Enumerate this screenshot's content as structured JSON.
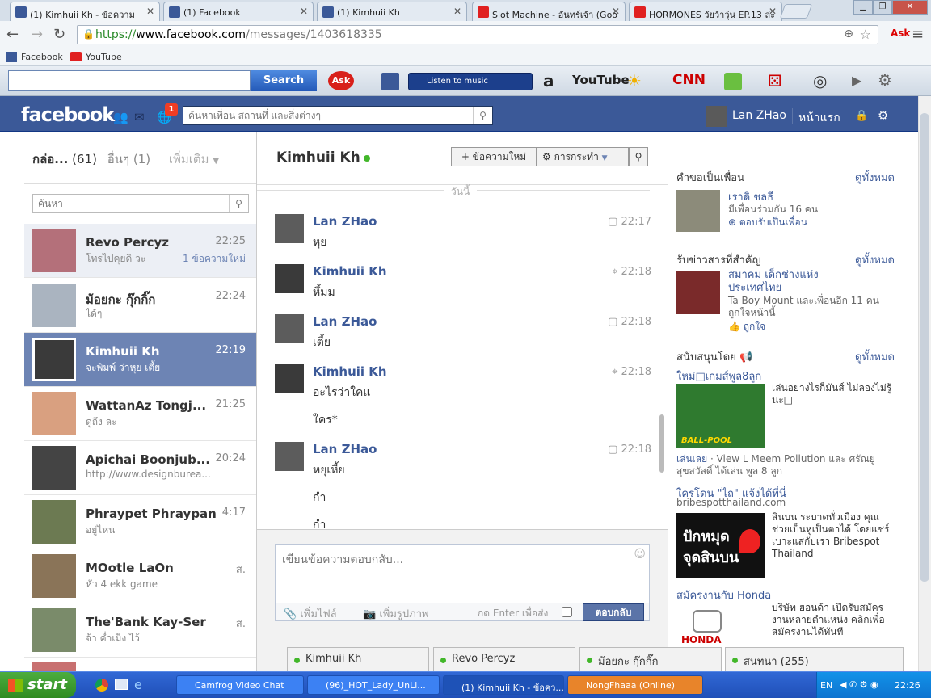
{
  "browser": {
    "tabs": [
      {
        "label": "(1) Kimhuii Kh - ข้อความ",
        "icon": "facebook-icon"
      },
      {
        "label": "(1) Facebook",
        "icon": "facebook-icon"
      },
      {
        "label": "(1) Kimhuii Kh",
        "icon": "facebook-icon"
      },
      {
        "label": "Slot Machine - อันทร์เจ้า (Goo",
        "icon": "youtube-icon"
      },
      {
        "label": "HORMONES วัยว้าวุ่น EP.13 ล่ะ",
        "icon": "youtube-icon"
      }
    ],
    "url_scheme": "https://",
    "url_host": "www.facebook.com",
    "url_path": "/messages/1403618335",
    "bookmarks": [
      "Facebook",
      "YouTube"
    ]
  },
  "asktoolbar": {
    "search_button": "Search",
    "ask_logo": "Ask",
    "music_label": "Listen to music",
    "youtube_label": "YouTube",
    "cnn_label": "CNN"
  },
  "fb": {
    "logo": "facebook",
    "notif_count": "1",
    "search_placeholder": "ค้นหาเพื่อน สถานที่ และสิ่งต่างๆ",
    "user_name": "Lan ZHao",
    "home_label": "หน้าแรก"
  },
  "left": {
    "tab_inbox": "กล่อ...",
    "tab_inbox_count": "(61)",
    "tab_other": "อื่นๆ",
    "tab_other_count": "(1)",
    "tab_more": "เพิ่มเติม",
    "search_placeholder": "ค้นหา",
    "threads": [
      {
        "name": "Revo Percyz",
        "time": "22:25",
        "snippet": "โทรไปคุยดิ วะ",
        "badge": "1 ข้อความใหม่"
      },
      {
        "name": "ม้อยกะ กุ๊กกิ๊ก",
        "time": "22:24",
        "snippet": "ได้ๆ"
      },
      {
        "name": "Kimhuii Kh",
        "time": "22:19",
        "snippet": "จะพิมพ์ ว่าหุย เตี้ย"
      },
      {
        "name": "WattanAz Tongj...",
        "time": "21:25",
        "snippet": "ดูถึง ละ"
      },
      {
        "name": "Apichai Boonjub...",
        "time": "20:24",
        "snippet": "http://www.designburea..."
      },
      {
        "name": "Phraypet Phraypan",
        "time": "4:17",
        "snippet": "อยู่ไหน"
      },
      {
        "name": "MOotle LaOn",
        "time": "ส.",
        "snippet": "หัว 4 ekk game"
      },
      {
        "name": "The'Bank Kay-Ser",
        "time": "ส.",
        "snippet": "จ้า ค่ำเม็ง ไว้"
      }
    ]
  },
  "convo": {
    "title": "Kimhuii Kh",
    "new_message_btn": "+ ข้อความใหม่",
    "actions_btn": "การกระทำ",
    "day_divider": "วันนี้",
    "messages": [
      {
        "name": "Lan ZHao",
        "time": "22:17",
        "lines": [
          "หุย"
        ]
      },
      {
        "name": "Kimhuii Kh",
        "time": "22:18",
        "lines": [
          "หึ้มม"
        ]
      },
      {
        "name": "Lan ZHao",
        "time": "22:18",
        "lines": [
          "เตี้ย"
        ]
      },
      {
        "name": "Kimhuii Kh",
        "time": "22:18",
        "lines": [
          "อะไรว่าใคแ",
          "ใคร*"
        ]
      },
      {
        "name": "Lan ZHao",
        "time": "22:18",
        "lines": [
          "หยุเหี้ย",
          "กำ",
          "กำ"
        ]
      }
    ],
    "reply_placeholder": "เขียนข้อความตอบกลับ...",
    "add_file": "เพิ่มไฟล์",
    "add_photo": "เพิ่มรูปภาพ",
    "enter_to_send": "กด Enter เพื่อส่ง",
    "reply_btn": "ตอบกลับ"
  },
  "right": {
    "friend_requests": "คำขอเป็นเพื่อน",
    "see_all": "ดูทั้งหมด",
    "fr_name": "เราดิ ชลธี",
    "fr_mutual": "มีเพื่อนร่วมกัน 16 คน",
    "fr_accept": "ตอบรับเป็นเพื่อน",
    "important": "รับข่าวสารที่สำคัญ",
    "page_name": "สมาคม เด็กช่างแห่งประเทศไทย",
    "page_likes": "Ta Boy Mount และเพื่อนอีก 11 คนถูกใจหน้านี้",
    "page_like_btn": "ถูกใจ",
    "sponsored": "สนับสนุนโดย",
    "ad1_title": "ใหม่□เกมส์พูล8ลูก",
    "ad1_text": "เล่นอย่างไรก็มันส์ ไม่ลองไม่รู้นะ□",
    "ad1_img": "BALL-POOL",
    "ad1_play": "เล่นเลย",
    "ad1_social": " · View L Meem Pollution และ ศรัณยู สุขสวัสดิ์ ได้เล่น พูล 8 ลูก",
    "ad2_title": "ใครโดน \"ไถ\" แจ้งได้ที่นี่",
    "ad2_domain": "bribespotthailand.com",
    "ad2_text": "สินบน ระบาดทั่วเมือง คุณช่วยเป็นหูเป็นตาได้ โดยแชร์เบาะแสกับเรา Bribespot Thailand",
    "ad2_img_line1": "ปักหมุด",
    "ad2_img_line2": "จุดสินบน",
    "ad3_title": "สมัครงานกับ Honda",
    "ad3_text": "บริษัท ฮอนด้า เปิดรับสมัครงานหลายตำแหน่ง คลิกเพื่อสมัครงานได้ทันที",
    "ad3_img": "HONDA"
  },
  "chat": {
    "tabs": [
      "Kimhuii Kh",
      "Revo Percyz",
      "ม้อยกะ กุ๊กกิ๊ก"
    ],
    "sidebar": "สนทนา (255)"
  },
  "taskbar": {
    "start": "start",
    "tasks": [
      "Camfrog Video Chat",
      "(96)_HOT_Lady_UnLi...",
      "(1) Kimhuii Kh - ข้อคว...",
      "NongFhaaa (Online)"
    ],
    "lang": "EN",
    "clock": "22:26"
  }
}
